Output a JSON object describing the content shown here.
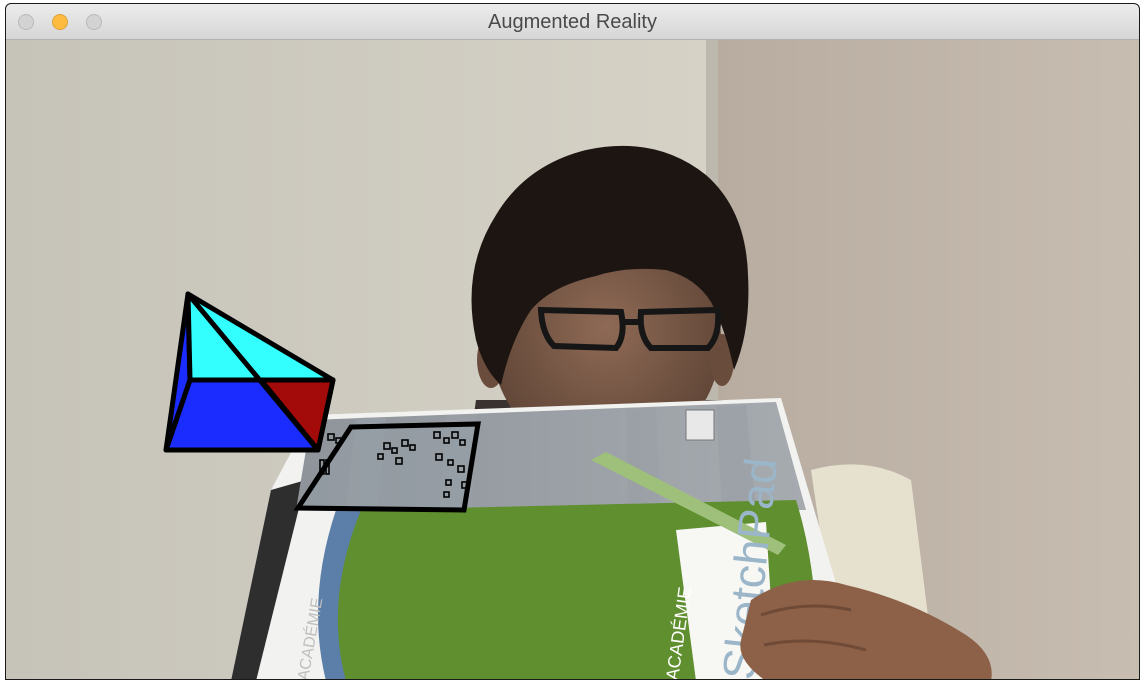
{
  "window": {
    "title": "Augmented Reality"
  },
  "controls": {
    "close_icon": "close-icon",
    "minimize_icon": "minimize-icon",
    "maximize_icon": "maximize-icon"
  },
  "colors": {
    "pyramid_top": "#33ffff",
    "pyramid_front": "#1a2cff",
    "pyramid_right": "#a30a0a",
    "notebook_green": "#5f8f2e",
    "wall": "#c9c2b8"
  },
  "scene": {
    "sketchpad_text": "SketchPad",
    "academie_text": "ACADÉMIE"
  }
}
